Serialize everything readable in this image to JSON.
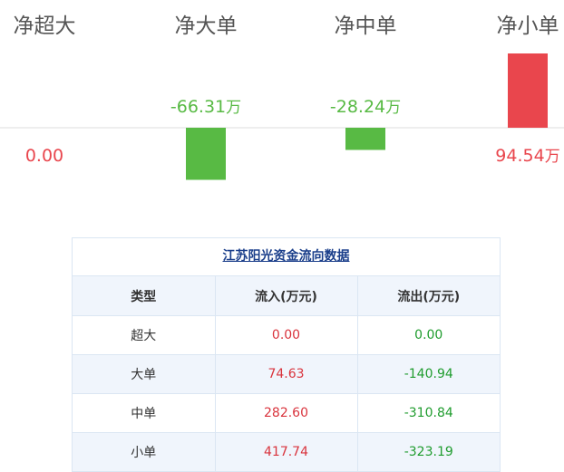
{
  "chart_data": {
    "type": "bar",
    "categories": [
      "净超大",
      "净大单",
      "净中单",
      "净小单"
    ],
    "values": [
      0.0,
      -66.31,
      -28.24,
      94.54
    ],
    "value_labels": [
      "0.00",
      "-66.31",
      "-28.24",
      "94.54"
    ],
    "unit": "万",
    "colors": {
      "positive": "#e9464d",
      "negative": "#58ba44",
      "zero": "#e9464d",
      "axis": "#dddddd"
    },
    "label_colors": {
      "positive": "#e9464d",
      "negative": "#58ba44",
      "zero": "#e9464d"
    }
  },
  "table": {
    "title": "江苏阳光资金流向数据",
    "headers": [
      "类型",
      "流入(万元)",
      "流出(万元)"
    ],
    "rows": [
      {
        "type": "超大",
        "inflow": "0.00",
        "outflow": "0.00"
      },
      {
        "type": "大单",
        "inflow": "74.63",
        "outflow": "-140.94"
      },
      {
        "type": "中单",
        "inflow": "282.60",
        "outflow": "-310.84"
      },
      {
        "type": "小单",
        "inflow": "417.74",
        "outflow": "-323.19"
      }
    ]
  }
}
